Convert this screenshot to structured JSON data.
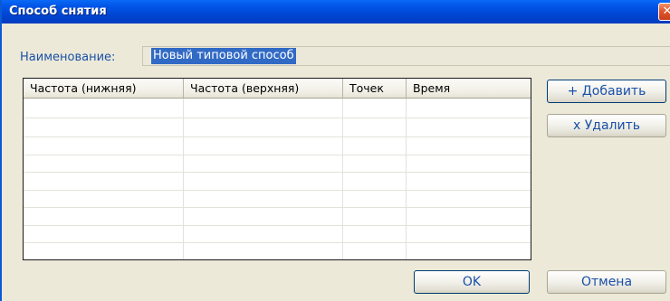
{
  "window": {
    "title": "Способ снятия",
    "close_glyph": "✕"
  },
  "form": {
    "name_label": "Наименование:",
    "name_value": "Новый типовой способ"
  },
  "grid": {
    "columns": [
      "Частота (нижняя)",
      "Частота (верхняя)",
      "Точек",
      "Время"
    ],
    "rows": []
  },
  "buttons": {
    "add": "+ Добавить",
    "delete": "х Удалить",
    "ok": "OK",
    "cancel": "Отмена"
  }
}
